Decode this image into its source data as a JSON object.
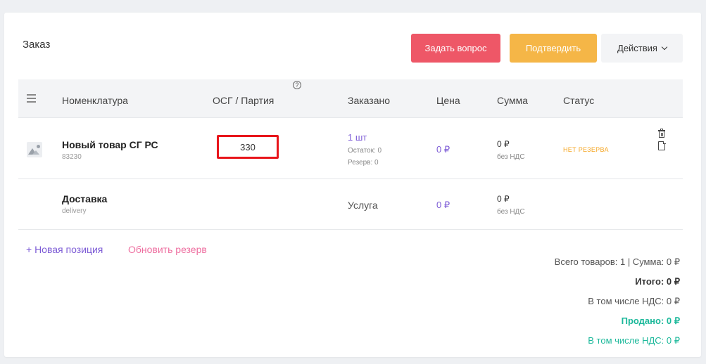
{
  "order": {
    "title": "Заказ",
    "buttons": {
      "ask": "Задать вопрос",
      "confirm": "Подтвердить",
      "actions": "Действия"
    },
    "columns": {
      "name": "Номенклатура",
      "osg": "ОСГ / Партия",
      "ordered": "Заказано",
      "price": "Цена",
      "sum": "Сумма",
      "status": "Статус"
    },
    "help_glyph": "?",
    "rows": [
      {
        "name": "Новый товар СГ РС",
        "sku": "83230",
        "osg_value": "330",
        "ordered": "1 шт",
        "remainder": "Остаток: 0",
        "reserve": "Резерв: 0",
        "price": "0 ₽",
        "sum": "0 ₽",
        "vat_note": "без НДС",
        "status": "НЕТ РЕЗЕРВА"
      },
      {
        "name": "Доставка",
        "sku": "delivery",
        "ordered": "Услуга",
        "price": "0 ₽",
        "sum": "0 ₽",
        "vat_note": "без НДС"
      }
    ],
    "links": {
      "new_position": "+ Новая позиция",
      "update_reserve": "Обновить резерв"
    },
    "totals": {
      "items_summary": "Всего товаров: 1 | Сумма: 0 ₽",
      "total": "Итого: 0 ₽",
      "vat_included": "В том числе НДС: 0 ₽",
      "sold": "Продано: 0 ₽",
      "sold_vat": "В том числе НДС: 0 ₽"
    }
  },
  "colors": {
    "ask_button": "#ee5767",
    "confirm_button": "#f5b647",
    "accent_purple": "#7d5cd6",
    "status_warning": "#f5a623",
    "sold_green": "#1bb89a",
    "highlight_border": "#e8151b"
  }
}
